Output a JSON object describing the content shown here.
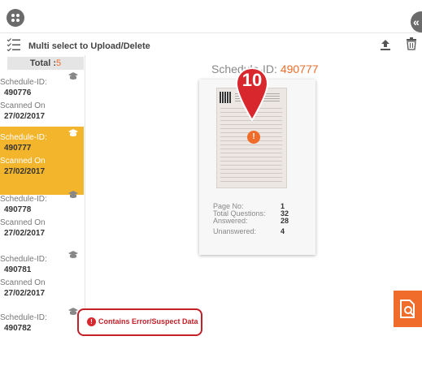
{
  "toolbar": {
    "multi_select_label": "Multi select to Upload/Delete"
  },
  "sidebar": {
    "total_label": "Total :",
    "total_count": "5",
    "items": [
      {
        "schedule_label": "Schedule-ID:",
        "schedule_id": "490776",
        "scanned_label": "Scanned On",
        "scanned_date": "27/02/2017"
      },
      {
        "schedule_label": "Schedule-ID:",
        "schedule_id": "490777",
        "scanned_label": "Scanned On",
        "scanned_date": "27/02/2017"
      },
      {
        "schedule_label": "Schedule-ID:",
        "schedule_id": "490778",
        "scanned_label": "Scanned On",
        "scanned_date": "27/02/2017"
      },
      {
        "schedule_label": "Schedule-ID:",
        "schedule_id": "490781",
        "scanned_label": "Scanned On",
        "scanned_date": "27/02/2017"
      },
      {
        "schedule_label": "Schedule-ID:",
        "schedule_id": "490782"
      }
    ]
  },
  "main": {
    "title_prefix": "Schedule-ID:",
    "title_id": "490777",
    "callout_number": "10",
    "error_glyph": "!",
    "stats": [
      {
        "label": "Page No:",
        "value": "1"
      },
      {
        "label": "Total Questions:",
        "value": "32"
      },
      {
        "label": "Answered:",
        "value": "28"
      },
      {
        "label": "Unanswered:",
        "value": "4"
      }
    ]
  },
  "legend": {
    "error_text": "Contains Error/Suspect Data"
  },
  "colors": {
    "accent": "#ef6c2a",
    "selected": "#f3b52c",
    "error": "#c32028",
    "icon_gray": "#6b6b6b"
  }
}
